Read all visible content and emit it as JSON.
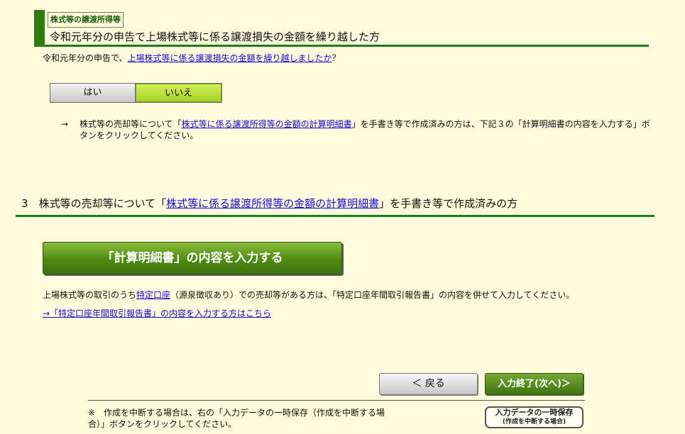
{
  "section1": {
    "tag": "株式等の譲渡所得等",
    "title": "令和元年分の申告で上場株式等に係る譲渡損失の金額を繰り越した方"
  },
  "question": {
    "prefix": "令和元年分の申告で、",
    "link": "上場株式等に係る譲渡損失の金額を繰り越しましたか",
    "suffix": "？"
  },
  "toggle": {
    "yes": "はい",
    "no": "いいえ",
    "selected": "いいえ"
  },
  "arrow_note": {
    "mark": "→",
    "pre": "株式等の売却等について「",
    "link": "株式等に係る譲渡所得等の金額の計算明細書",
    "post": "」を手書き等で作成済みの方は、下記３の「計算明細書の内容を入力する」ボタンをクリックしてください。"
  },
  "section3": {
    "num": "3",
    "pre": "株式等の売却等について「",
    "link": "株式等に係る譲渡所得等の金額の計算明細書",
    "post": "」を手書き等で作成済みの方"
  },
  "enter_button": "「計算明細書」の内容を入力する",
  "tokutei": {
    "pre": "上場株式等の取引のうち",
    "link": "特定口座",
    "post": "（源泉徴収あり）での売却等がある方は、「特定口座年間取引報告書」の内容を併せて入力してください。"
  },
  "tokutei_link": "→「特定口座年間取引報告書」の内容を入力する方はこちら",
  "nav": {
    "back": "＜ 戻る",
    "next": "入力終了(次へ)＞"
  },
  "save_note": "※　作成を中断する場合は、右の「入力データの一時保存（作成を中断する場合）」ボタンをクリックしてください。",
  "save_button": {
    "line1": "入力データの一時保存",
    "line2": "(作成を中断する場合)"
  }
}
